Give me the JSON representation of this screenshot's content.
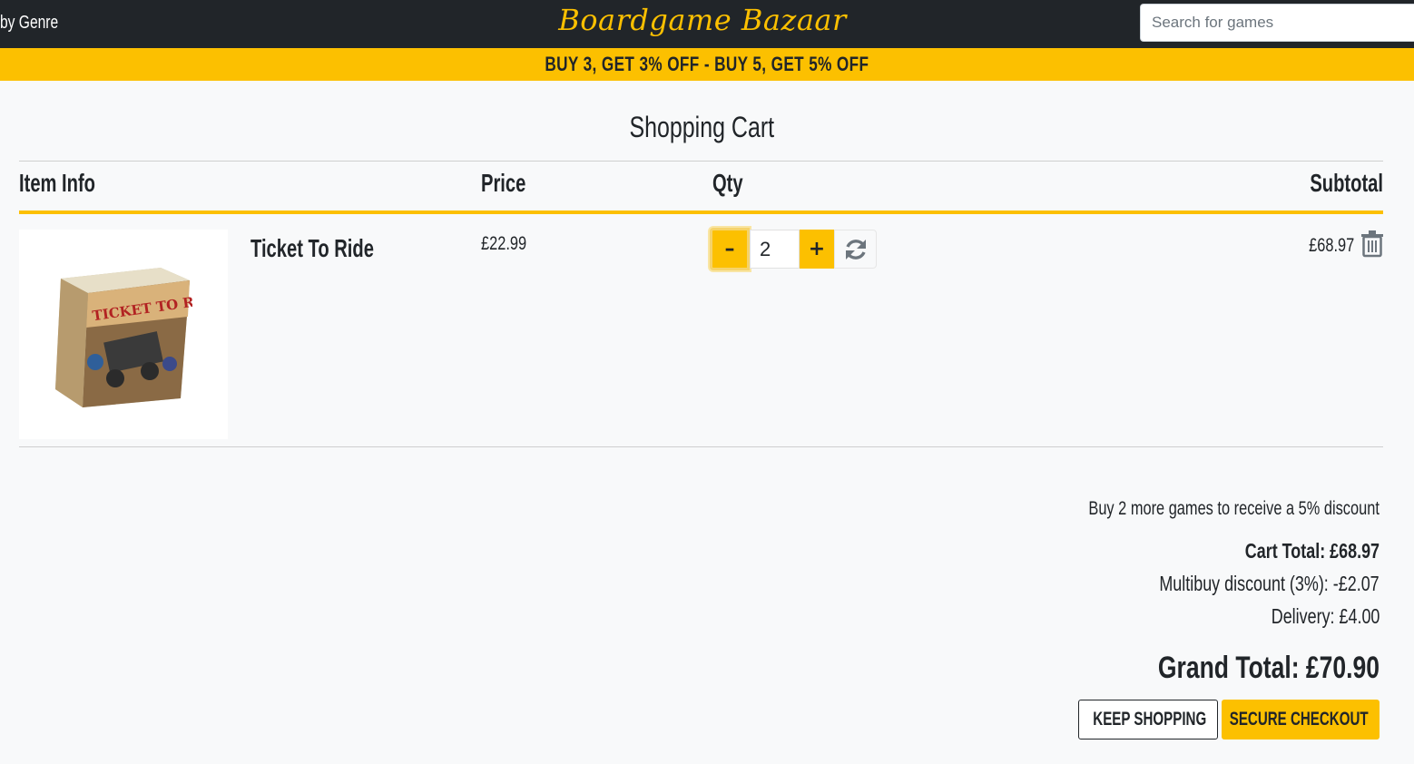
{
  "nav": {
    "genre_link": "by Genre",
    "brand": "Boardgame Bazaar",
    "search_placeholder": "Search for games"
  },
  "promo_banner": "BUY 3, GET 3% OFF - BUY 5, GET 5% OFF",
  "page_title": "Shopping Cart",
  "table": {
    "headers": {
      "item_info": "Item Info",
      "price": "Price",
      "qty": "Qty",
      "subtotal": "Subtotal"
    }
  },
  "cart_items": [
    {
      "name": "Ticket To Ride",
      "image_text": "TICKET TO RIDE",
      "price": "£22.99",
      "quantity": "2",
      "subtotal": "£68.97"
    }
  ],
  "summary": {
    "discount_message": "Buy 2 more games to receive a 5% discount",
    "cart_total": "Cart Total: £68.97",
    "multibuy_discount": "Multibuy discount (3%): -£2.07",
    "delivery": "Delivery: £4.00",
    "grand_total": "Grand Total: £70.90"
  },
  "buttons": {
    "keep_shopping": "KEEP SHOPPING",
    "secure_checkout": "SECURE CHECKOUT"
  },
  "colors": {
    "accent": "#fcc000",
    "navbar": "#212529",
    "background": "#f8f9fa"
  },
  "icons": {
    "qty_decrease": "minus-icon",
    "qty_increase": "plus-icon",
    "qty_update": "refresh-icon",
    "remove_item": "trash-icon",
    "keep_shopping": "chevron-left-icon",
    "checkout": "lock-icon"
  }
}
